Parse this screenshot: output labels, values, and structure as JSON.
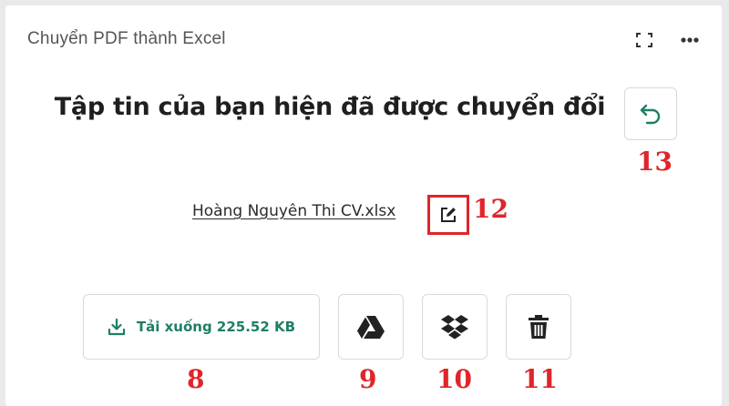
{
  "header": {
    "title": "Chuyển PDF thành Excel",
    "icons": [
      "expand-icon",
      "more-options-icon"
    ]
  },
  "main": {
    "heading": "Tập tin của bạn hiện đã được chuyển đổi",
    "file_name": "Hoàng Nguyên Thi CV.xlsx"
  },
  "actions": {
    "download_label": "Tải xuống 225.52 KB",
    "icons": [
      "download-icon",
      "google-drive-icon",
      "dropbox-icon",
      "trash-icon",
      "undo-icon",
      "edit-icon"
    ]
  },
  "annotations": {
    "download": "8",
    "google_drive": "9",
    "dropbox": "10",
    "delete": "11",
    "rename": "12",
    "undo": "13"
  },
  "colors": {
    "accent_green": "#1e7e66",
    "annotation_red": "#e0252a"
  }
}
